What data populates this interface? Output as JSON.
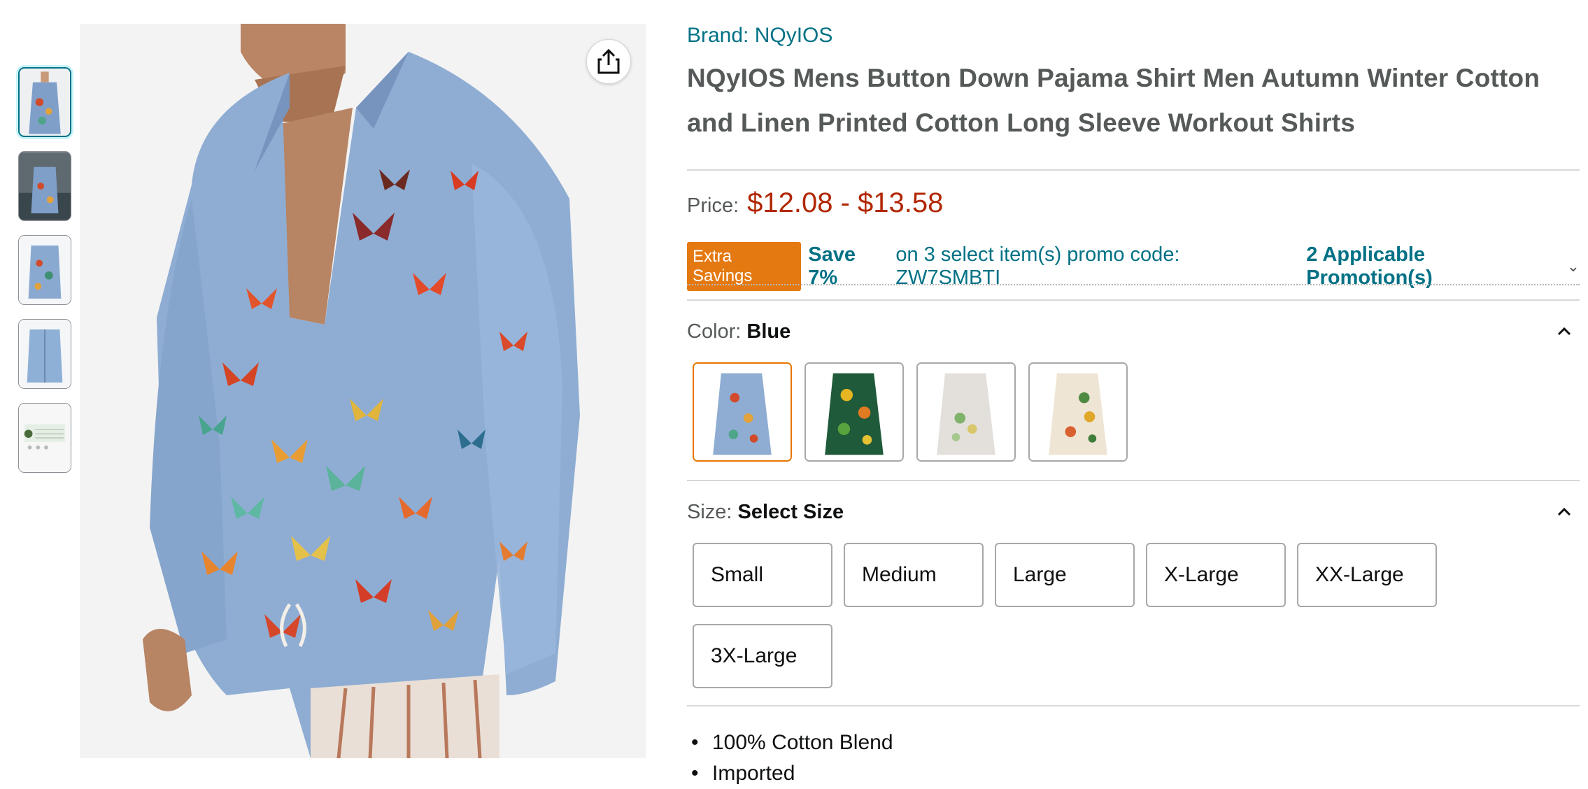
{
  "product": {
    "brand_label": "Brand: NQyIOS",
    "title": "NQyIOS Mens Button Down Pajama Shirt Men Autumn Winter Cotton and Linen Printed Cotton Long Sleeve Workout Shirts"
  },
  "price": {
    "label": "Price:",
    "value": "$12.08 - $13.58"
  },
  "promo": {
    "badge": "Extra Savings",
    "save": "Save 7%",
    "text": "on 3 select item(s) promo code: ZW7SMBTI",
    "link": "2 Applicable Promotion(s)"
  },
  "color": {
    "label": "Color:",
    "selected": "Blue"
  },
  "size": {
    "label": "Size:",
    "selected": "Select Size",
    "options": [
      "Small",
      "Medium",
      "Large",
      "X-Large",
      "XX-Large",
      "3X-Large"
    ]
  },
  "bullets": [
    "100% Cotton Blend",
    "Imported"
  ],
  "colors": {
    "link": "#007185",
    "price": "#b12704",
    "badge": "#e47911",
    "selected_swatch": "#e77600"
  },
  "icons": {
    "share": "share-icon",
    "collapse": "chevron-up-icon",
    "promo_expand": "chevron-down-icon"
  }
}
